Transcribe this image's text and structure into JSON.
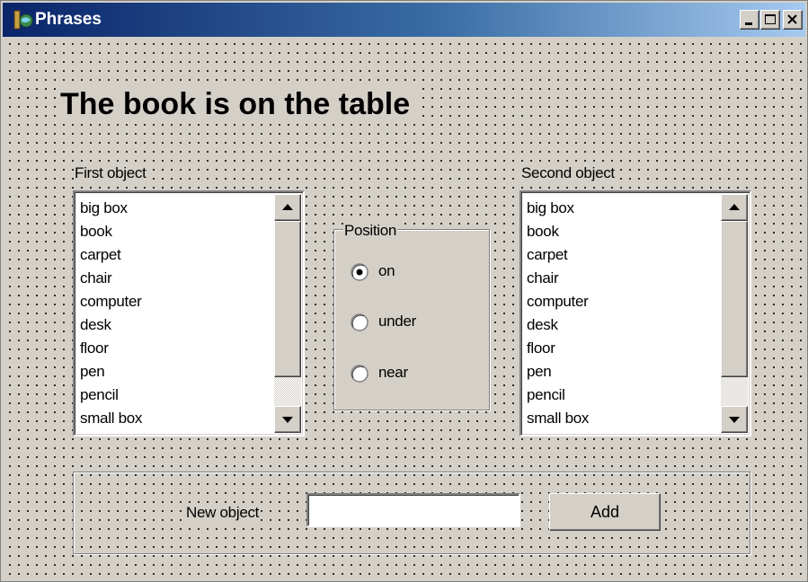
{
  "window": {
    "title": "Phrases",
    "icon": "delphi-app-icon",
    "controls": [
      "minimize-icon",
      "maximize-icon",
      "close-icon"
    ]
  },
  "heading": "The book is on the table",
  "first_object": {
    "label": "First object",
    "items": [
      "big box",
      "book",
      "carpet",
      "chair",
      "computer",
      "desk",
      "floor",
      "pen",
      "pencil",
      "small box"
    ]
  },
  "second_object": {
    "label": "Second object",
    "items": [
      "big box",
      "book",
      "carpet",
      "chair",
      "computer",
      "desk",
      "floor",
      "pen",
      "pencil",
      "small box"
    ]
  },
  "position": {
    "title": "Position",
    "options": [
      {
        "label": "on",
        "checked": true
      },
      {
        "label": "under",
        "checked": false
      },
      {
        "label": "near",
        "checked": false
      }
    ]
  },
  "new_object": {
    "label": "New object",
    "value": "",
    "button_label": "Add"
  },
  "colors": {
    "face": "#d4d0c8",
    "title_start": "#0a246a",
    "title_end": "#a6caf0",
    "title_text": "#ffffff"
  }
}
